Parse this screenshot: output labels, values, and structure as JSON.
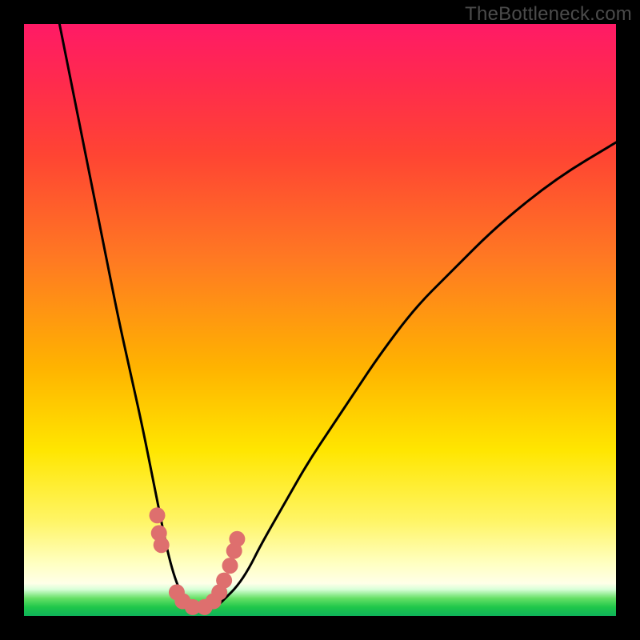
{
  "watermark": "TheBottleneck.com",
  "colors": {
    "frameBg": "#000000",
    "curveStroke": "#000000",
    "markerFill": "#de6f6e",
    "gradientTop": "#ff1a66",
    "gradientBottom": "#0eb35a"
  },
  "chart_data": {
    "type": "line",
    "title": "",
    "xlabel": "",
    "ylabel": "",
    "xlim": [
      0,
      100
    ],
    "ylim": [
      0,
      100
    ],
    "grid": false,
    "series": [
      {
        "name": "bottleneck-curve",
        "x": [
          6,
          8,
          10,
          12,
          14,
          16,
          18,
          20,
          22,
          23,
          24,
          25,
          26,
          27,
          28,
          29,
          30,
          31,
          32,
          33,
          34,
          36,
          38,
          40,
          44,
          48,
          52,
          56,
          60,
          66,
          72,
          80,
          90,
          100
        ],
        "y": [
          100,
          90,
          80,
          70,
          60,
          50,
          41,
          32,
          22,
          17,
          12,
          8,
          5,
          3,
          2,
          1.5,
          1.2,
          1.2,
          1.5,
          2,
          3,
          5,
          8,
          12,
          19,
          26,
          32,
          38,
          44,
          52,
          58,
          66,
          74,
          80
        ],
        "note": "y is bottleneck percentage; valley ≈ 0 around x≈28–31; curve clipped at top (y=100) on the left edge"
      }
    ],
    "annotations": [
      {
        "name": "valley-markers",
        "description": "clustered pink dots along the curve near the valley bottom on both sides",
        "points": [
          {
            "x": 22.5,
            "y": 17
          },
          {
            "x": 22.8,
            "y": 14
          },
          {
            "x": 23.2,
            "y": 12
          },
          {
            "x": 25.8,
            "y": 4
          },
          {
            "x": 26.8,
            "y": 2.5
          },
          {
            "x": 28.5,
            "y": 1.5
          },
          {
            "x": 30.5,
            "y": 1.5
          },
          {
            "x": 32.0,
            "y": 2.5
          },
          {
            "x": 33.0,
            "y": 4
          },
          {
            "x": 33.8,
            "y": 6
          },
          {
            "x": 34.8,
            "y": 8.5
          },
          {
            "x": 35.5,
            "y": 11
          },
          {
            "x": 36.0,
            "y": 13
          }
        ]
      }
    ]
  }
}
